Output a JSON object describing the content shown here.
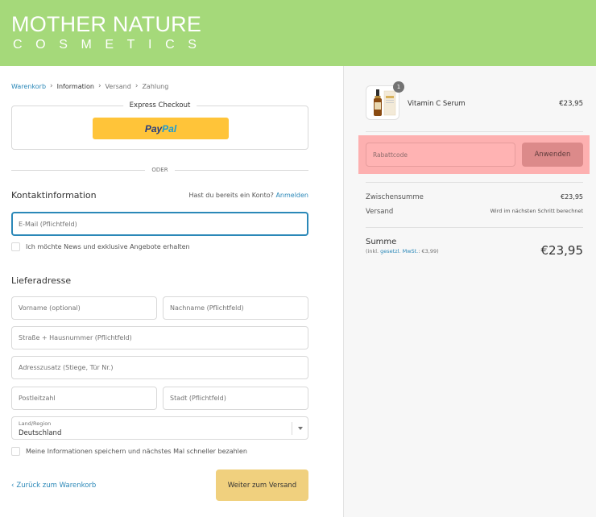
{
  "header": {
    "logo_line1": "MOTHER NATURE",
    "logo_line2": "COSMETICS",
    "bg_color": "#a5d97a"
  },
  "breadcrumb": {
    "cart": "Warenkorb",
    "information": "Information",
    "shipping": "Versand",
    "payment": "Zahlung"
  },
  "express_checkout": {
    "title": "Express Checkout",
    "paypal_part1": "Pay",
    "paypal_part2": "Pal"
  },
  "divider_label": "ODER",
  "contact": {
    "title": "Kontaktinformation",
    "account_prompt": "Hast du bereits ein Konto?",
    "login_link": "Anmelden",
    "email_placeholder": "E-Mail (Pflichtfeld)",
    "newsletter_label": "Ich möchte News und exklusive Angebote erhalten"
  },
  "shipping_address": {
    "title": "Lieferadresse",
    "first_name_placeholder": "Vorname (optional)",
    "last_name_placeholder": "Nachname (Pflichtfeld)",
    "street_placeholder": "Straße + Hausnummer (Pflichtfeld)",
    "address2_placeholder": "Adresszusatz (Stiege, Tür Nr.)",
    "zip_placeholder": "Postleitzahl",
    "city_placeholder": "Stadt (Pflichtfeld)",
    "country_label": "Land/Region",
    "country_value": "Deutschland",
    "save_info_label": "Meine Informationen speichern und nächstes Mal schneller bezahlen"
  },
  "footer_actions": {
    "back_label": "Zurück zum Warenkorb",
    "continue_label": "Weiter zum Versand"
  },
  "order_summary": {
    "product_name": "Vitamin C Serum",
    "product_price": "€23,95",
    "quantity": "1",
    "discount_placeholder": "Rabattcode",
    "apply_label": "Anwenden",
    "subtotal_label": "Zwischensumme",
    "subtotal_value": "€23,95",
    "shipping_label": "Versand",
    "shipping_value": "Wird im nächsten Schritt berechnet",
    "total_label": "Summe",
    "tax_prefix": "(inkl. ",
    "tax_link": "gesetzl. MwSt.",
    "tax_suffix": ": €3,99)",
    "total_value": "€23,95"
  },
  "colors": {
    "accent": "#2b88b8",
    "paypal_yellow": "#ffc439",
    "continue_button": "#f0d07e",
    "discount_highlight": "#fdb0b0"
  }
}
